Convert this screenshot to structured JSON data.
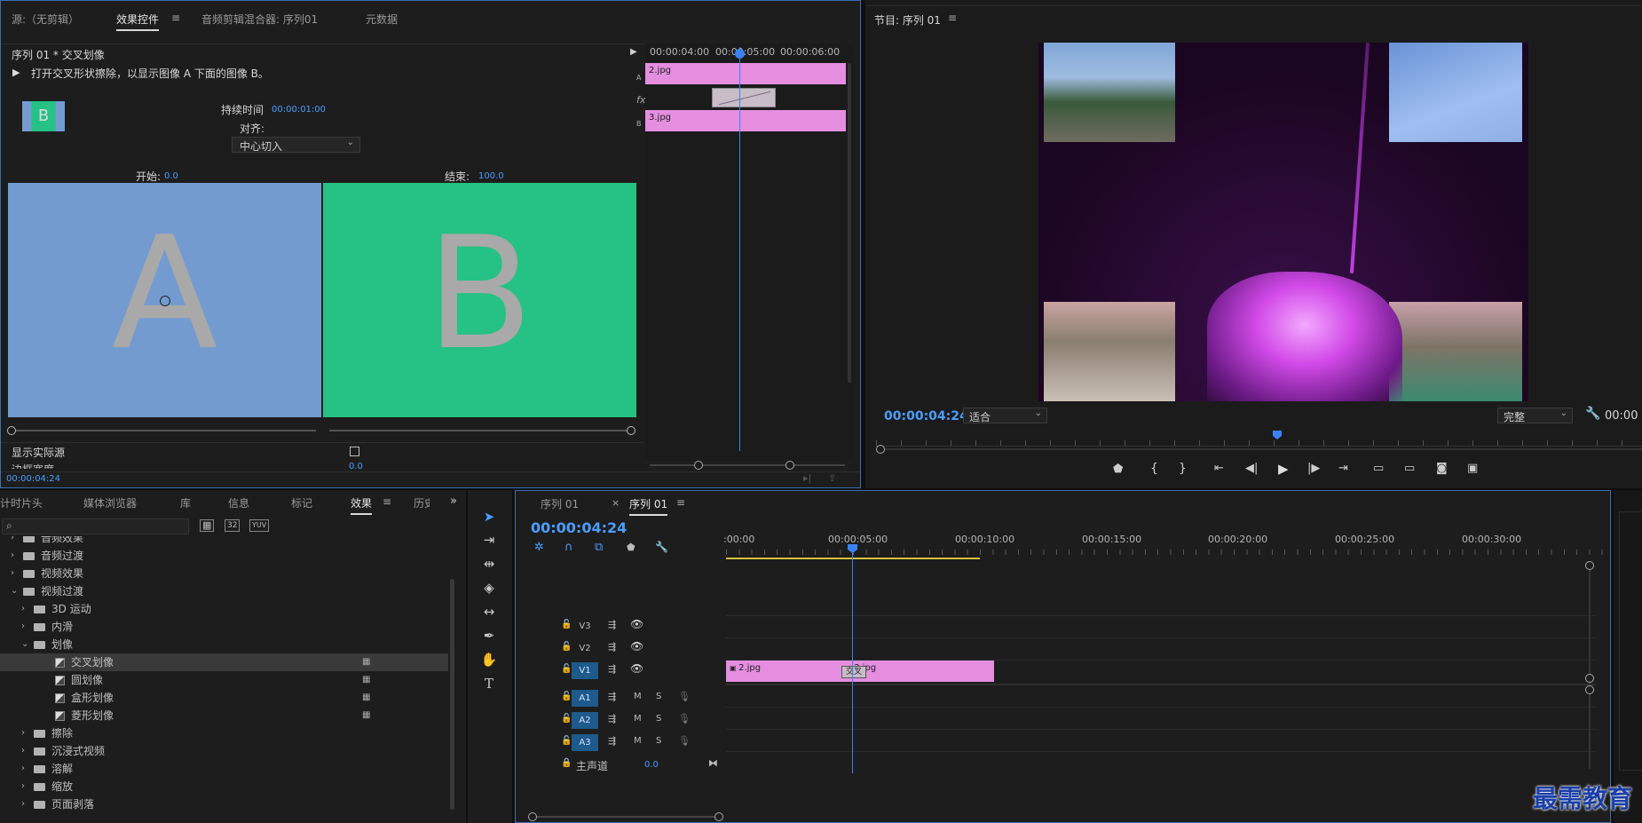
{
  "source_panel": {
    "tabs": [
      "源:（无剪辑）",
      "效果控件",
      "音频剪辑混合器: 序列01",
      "元数据"
    ],
    "active_tab": "效果控件",
    "clip_path": "序列 01 * 交叉划像",
    "description": "打开交叉形状擦除，以显示图像 A 下面的图像 B。",
    "thumb_letter": "B",
    "duration_label": "持续时间",
    "duration_value": "00:00:01:00",
    "align_label": "对齐:",
    "align_value": "中心切入",
    "start_label": "开始:",
    "start_value": "0.0",
    "end_label": "结束:",
    "end_value": "100.0",
    "preview_a": "A",
    "preview_b": "B",
    "show_source_label": "显示实际源",
    "border_width_label": "边框宽度",
    "border_width_value": "0.0",
    "timecode": "00:00:04:24",
    "mini_timeline": {
      "ruler": [
        "00:00:04:00",
        "00:00:05:00",
        "00:00:06:00"
      ],
      "track_a": "A",
      "track_b": "B",
      "clip_a": "2.jpg",
      "clip_b": "3.jpg",
      "fx_label": "fx"
    }
  },
  "program_panel": {
    "title": "节目: 序列 01",
    "timecode": "00:00:04:24",
    "fit_value": "适合",
    "quality_value": "完整",
    "right_timecode": "00:00"
  },
  "project_panel": {
    "tabs": [
      "计时片头",
      "媒体浏览器",
      "库",
      "信息",
      "标记",
      "效果",
      "历史"
    ],
    "active_tab": "效果",
    "search_placeholder": "",
    "icon_labels": [
      "32",
      "YUV"
    ],
    "tree": [
      {
        "label": "音频效果",
        "level": 0,
        "type": "folder",
        "expanded": false
      },
      {
        "label": "音频过渡",
        "level": 0,
        "type": "folder",
        "expanded": false
      },
      {
        "label": "视频效果",
        "level": 0,
        "type": "folder",
        "expanded": false
      },
      {
        "label": "视频过渡",
        "level": 0,
        "type": "folder",
        "expanded": true
      },
      {
        "label": "3D 运动",
        "level": 1,
        "type": "folder",
        "expanded": false
      },
      {
        "label": "内滑",
        "level": 1,
        "type": "folder",
        "expanded": false
      },
      {
        "label": "划像",
        "level": 1,
        "type": "folder",
        "expanded": true
      },
      {
        "label": "交叉划像",
        "level": 2,
        "type": "fx",
        "selected": true
      },
      {
        "label": "圆划像",
        "level": 2,
        "type": "fx"
      },
      {
        "label": "盒形划像",
        "level": 2,
        "type": "fx"
      },
      {
        "label": "菱形划像",
        "level": 2,
        "type": "fx"
      },
      {
        "label": "擦除",
        "level": 1,
        "type": "folder",
        "expanded": false
      },
      {
        "label": "沉浸式视频",
        "level": 1,
        "type": "folder",
        "expanded": false
      },
      {
        "label": "溶解",
        "level": 1,
        "type": "folder",
        "expanded": false
      },
      {
        "label": "缩放",
        "level": 1,
        "type": "folder",
        "expanded": false
      },
      {
        "label": "页面剥落",
        "level": 1,
        "type": "folder",
        "expanded": false
      }
    ]
  },
  "timeline_panel": {
    "tabs": [
      "序列 01",
      "序列 01"
    ],
    "close_mark": "×",
    "timecode": "00:00:04:24",
    "ruler": [
      ":00:00",
      "00:00:05:00",
      "00:00:10:00",
      "00:00:15:00",
      "00:00:20:00",
      "00:00:25:00",
      "00:00:30:00"
    ],
    "video_tracks": [
      "V3",
      "V2",
      "V1"
    ],
    "audio_tracks": [
      "A1",
      "A2",
      "A3"
    ],
    "mute": "M",
    "solo": "S",
    "master_label": "主声道",
    "master_value": "0.0",
    "clip1": "2.jpg",
    "clip2": "3.jpg",
    "transition_label": "交叉"
  },
  "watermark": "最需教育",
  "colors": {
    "accent_blue": "#4a9eff",
    "clip_pink": "#e58ee0",
    "preview_a_bg": "#739bd0",
    "preview_b_bg": "#26c185",
    "playhead": "#3b82f6"
  }
}
